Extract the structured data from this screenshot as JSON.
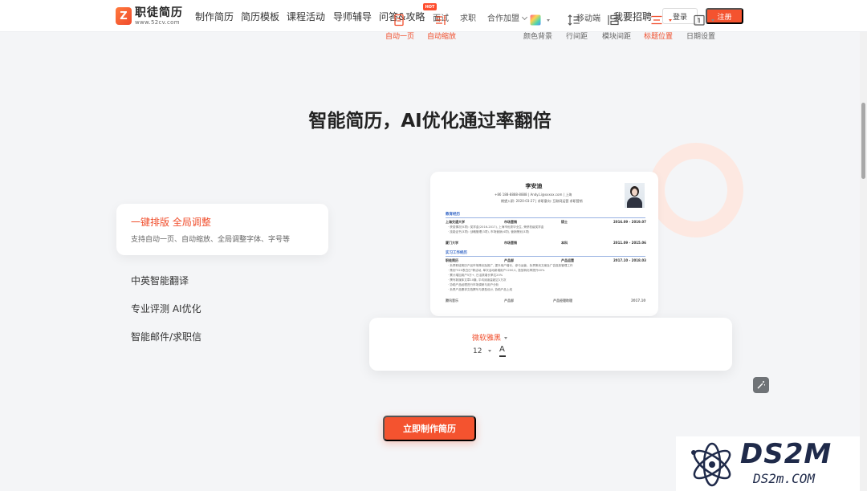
{
  "nav": {
    "logo_mark": "Z",
    "logo_title": "职徒简历",
    "logo_url": "www.52cv.com",
    "links": [
      "制作简历",
      "简历模板",
      "课程活动",
      "导师辅导",
      "问答&攻略"
    ],
    "small_links": [
      "面试",
      "求职"
    ],
    "coop": "合作加盟",
    "hot_badge": "HOT",
    "mobile": "移动端",
    "recruit": "我要招聘",
    "login": "登录",
    "register": "注册"
  },
  "main": {
    "heading": "智能简历，AI优化通过率翻倍",
    "active_feature": {
      "title": "一键排版 全局调整",
      "desc": "支持自动一页、自动缩放、全局调整字体、字号等"
    },
    "features": [
      "中英智能翻译",
      "专业评测 AI优化",
      "智能邮件/求职信"
    ],
    "cta": "立即制作简历"
  },
  "resume": {
    "name": "李安迪",
    "contact": "+86 188-8888-8888  |  Andy.Li@xxxxx.com  |  上海",
    "intent": "期望入职: 2020-03-27  |  求职意向: 互联网运营  求职营销",
    "sections": [
      {
        "title": "教育经历",
        "rows": [
          {
            "left": "上海交通大学",
            "mid": "市场营销",
            "right": "硕士",
            "date": "2016.09 - 2019.07"
          },
          {
            "left": "厦门大学",
            "mid": "市场营销",
            "right": "本科",
            "date": "2011.09 - 2015.06"
          }
        ],
        "texts": [
          "· 获奖情况(5项): 奖学金(2016-2017), 上海市优秀毕业生, 荣获校级奖学金",
          "· 技能证书(3项): 战略管理(3项), 市场营销(4项), 营销策划(3项)"
        ]
      },
      {
        "title": "实习工作经历",
        "rows": [
          {
            "left": "职徒简历",
            "mid": "产品部",
            "right": "产品运营",
            "date": "2017.10 - 2018.03"
          },
          {
            "left": "腾讯音乐",
            "mid": "产品部",
            "right": "产品经理助理",
            "date": "2017.10"
          }
        ],
        "texts": [
          "· 负责职徒简历产品市场策划及推广, 提升用户增长、参与运营、负责策划文案及广告投放管理工作",
          "· 策划\"520表白日\"等活动, 单次活动新增用户1200人, 投放转化率提升40%",
          "· 累计增加用户5万+, 日活跃增长率达20%",
          "· 撰写新媒体文章10篇, 平均阅读量超过1万次",
          "· 协助产品经理进行市场调研与用户分析",
          "· 负责产品需求文档撰写与原型设计, 协助产品上线"
        ]
      }
    ]
  },
  "toolbar": {
    "auto_page": "自动一页",
    "auto_scale": "自动缩放",
    "font": "微软雅黑",
    "size": "12",
    "color_a": "A",
    "color_bg": "颜色背景",
    "line_spacing": "行间距",
    "module_spacing": "模块间距",
    "title_position": "标题位置",
    "date_setting": "日期设置"
  },
  "watermark": {
    "text1": "DS2M",
    "text2": "DS2m.COM"
  },
  "colors": {
    "accent": "#f4532f",
    "accent_text": "#f04e2c",
    "resume_blue": "#3567c6"
  }
}
